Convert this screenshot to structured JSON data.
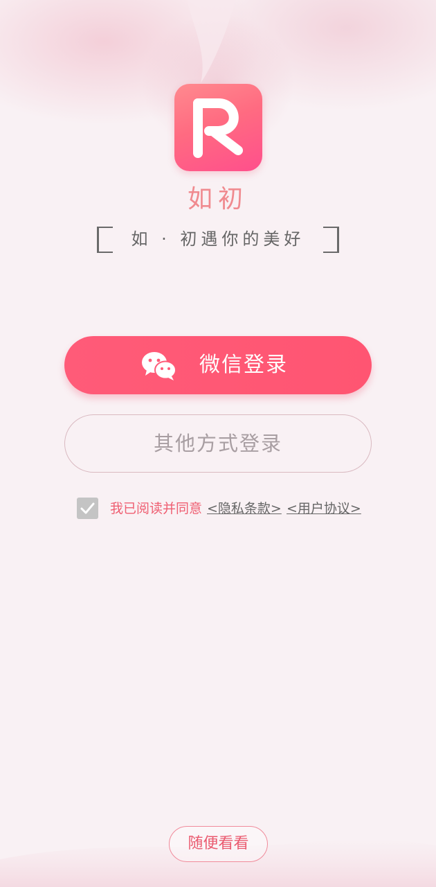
{
  "app": {
    "name": "如初",
    "slogan": "如 · 初遇你的美好"
  },
  "login": {
    "wechat_label": "微信登录",
    "other_label": "其他方式登录"
  },
  "agreement": {
    "checked": true,
    "prefix": "我已阅读并同意",
    "privacy_link": "<隐私条款>",
    "user_link": "<用户协议>"
  },
  "browse": {
    "label": "随便看看"
  },
  "colors": {
    "accent": "#ff5b78",
    "background": "#f9f1f4",
    "link_gray": "#666666",
    "agree_text": "#ef5f72"
  },
  "icons": {
    "logo": "letter-r-logo",
    "wechat": "wechat-icon",
    "checkbox": "check-icon"
  }
}
